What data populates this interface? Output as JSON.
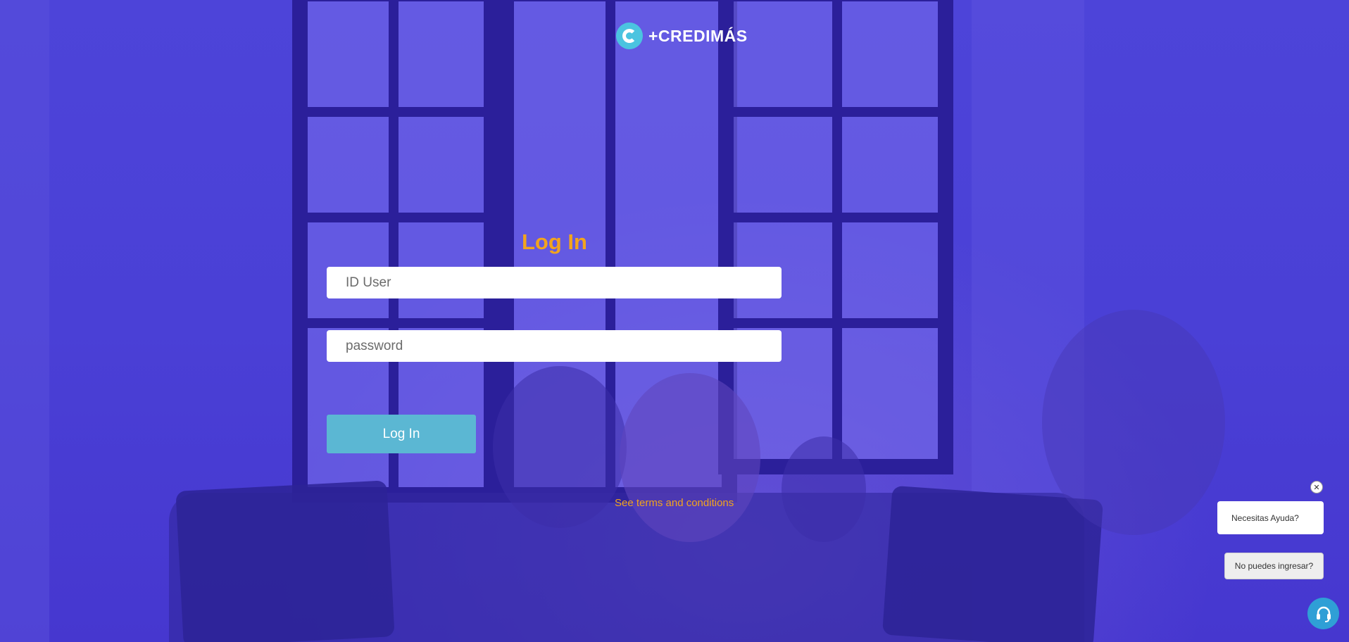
{
  "brand": {
    "name": "+CREDIMÁS",
    "logo_icon": "credimas-logo-icon"
  },
  "login": {
    "title": "Log In",
    "user_placeholder": "ID User",
    "password_placeholder": "password",
    "submit_label": "Log In",
    "terms_link": "See terms and conditions"
  },
  "chat": {
    "close_glyph": "✕",
    "help_text": "Necesitas Ayuda?",
    "cant_login_label": "No puedes ingresar?",
    "support_icon": "headset-icon"
  },
  "colors": {
    "background": "#4a3fd6",
    "accent": "#f2a41e",
    "button": "#5bb7d3"
  }
}
